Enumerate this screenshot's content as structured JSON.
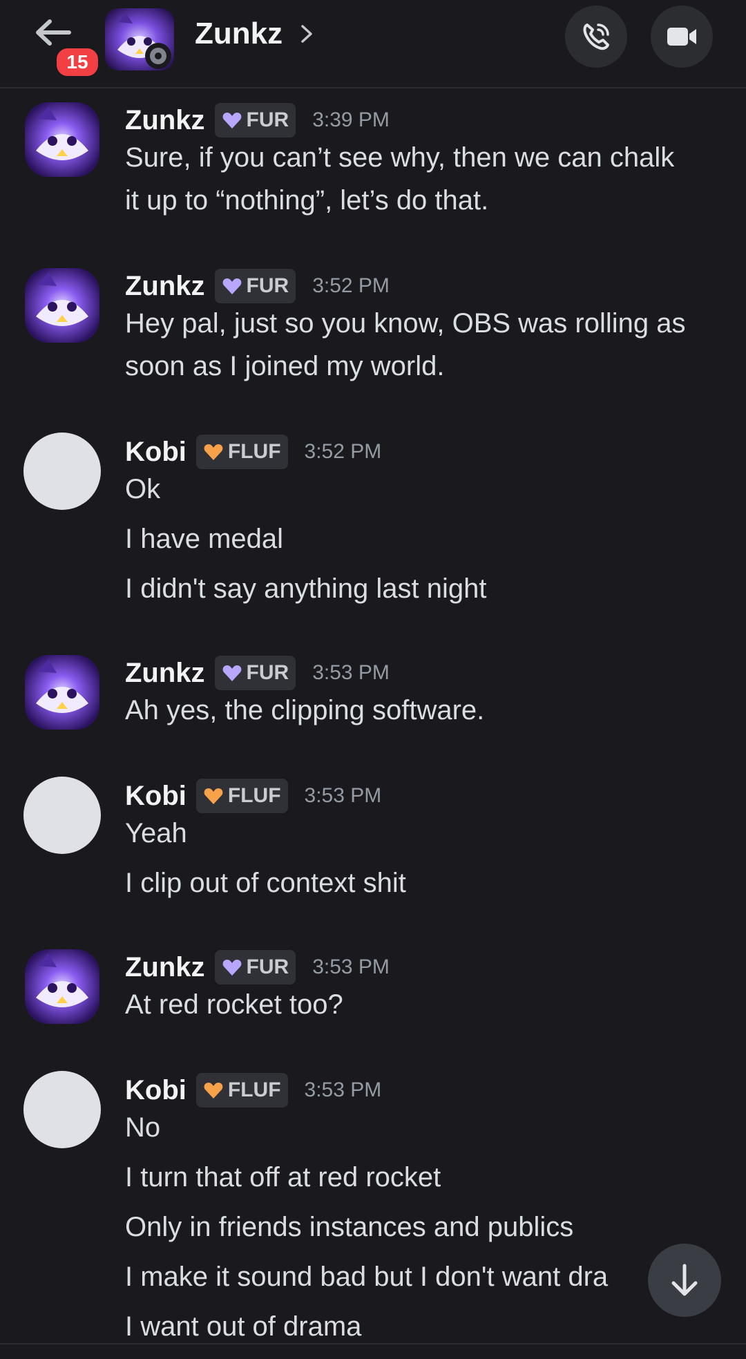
{
  "header": {
    "title": "Zunkz",
    "badge_count": "15",
    "icons": [
      "back-arrow-icon",
      "chevron-right-icon",
      "phone-call-icon",
      "video-camera-icon"
    ]
  },
  "colors": {
    "background": "#1a1a1e",
    "badge": "#f23f43",
    "fur_heart": "#b9a6ff",
    "fluf_heart": "#f7a24a",
    "timestamp": "#949ba4"
  },
  "messages": [
    {
      "author": "Zunkz",
      "tag": "FUR",
      "time": "3:39 PM",
      "lines": [
        "Sure, if you can’t see why, then we can chalk",
        "it up to “nothing”, let’s do that."
      ]
    },
    {
      "author": "Zunkz",
      "tag": "FUR",
      "time": "3:52 PM",
      "lines": [
        "Hey pal, just so you know, OBS was rolling as",
        "soon as I joined my world."
      ]
    },
    {
      "author": "Kobi",
      "tag": "FLUF",
      "time": "3:52 PM",
      "lines": [
        "Ok",
        "I have medal",
        "I didn't say anything last night"
      ]
    },
    {
      "author": "Zunkz",
      "tag": "FUR",
      "time": "3:53 PM",
      "lines": [
        "Ah yes, the clipping software."
      ]
    },
    {
      "author": "Kobi",
      "tag": "FLUF",
      "time": "3:53 PM",
      "lines": [
        "Yeah",
        "I clip out of context shit"
      ]
    },
    {
      "author": "Zunkz",
      "tag": "FUR",
      "time": "3:53 PM",
      "lines": [
        "At red rocket too?"
      ]
    },
    {
      "author": "Kobi",
      "tag": "FLUF",
      "time": "3:53 PM",
      "lines": [
        "No",
        "I turn that off at red rocket",
        "Only in friends instances and publics",
        "I make it sound bad but I don't want dra",
        "I want out of drama"
      ]
    }
  ],
  "scroll_button_icon": "arrow-down-icon"
}
